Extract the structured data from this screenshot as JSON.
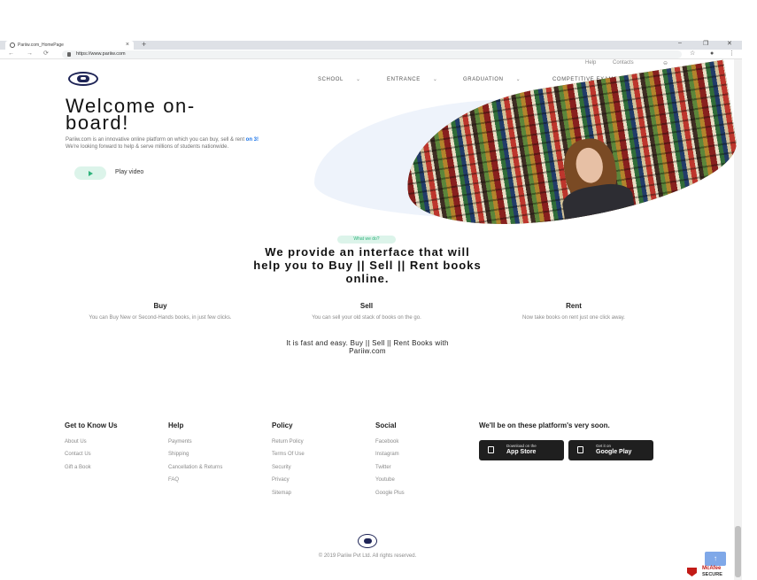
{
  "browser": {
    "tab_title": "Pariiw.com_HomePage",
    "tab_close": "×",
    "new_tab": "+",
    "url": "https://www.pariiw.com",
    "win_min": "–",
    "win_max": "❐",
    "win_close": "✕",
    "back": "←",
    "forward": "→",
    "reload": "⟳",
    "star": "☆",
    "menu": "⋮"
  },
  "header": {
    "utility_links": [
      "Help",
      "Contacts"
    ],
    "cart_icon": "⊖",
    "nav": [
      {
        "label": "SCHOOL",
        "chevron": "⌄"
      },
      {
        "label": "ENTRANCE",
        "chevron": "⌄"
      },
      {
        "label": "GRADUATION",
        "chevron": "⌄"
      },
      {
        "label": "COMPETITIVE EXAMS",
        "chevron": "⌄"
      }
    ]
  },
  "hero": {
    "title_line1": "Welcome on-",
    "title_line2": "board!",
    "desc_part1": "Pariiw.com is an innovative online platform on which you can buy, sell & rent ",
    "desc_accent": "on 3!",
    "desc_part2": "We're looking forward to help & serve millions of students nationwide.",
    "play_label": "Play video"
  },
  "about": {
    "pill": "What we do?",
    "title_line1": "We provide an interface that will",
    "title_line2": "help you to Buy || Sell || Rent books",
    "title_line3": "online.",
    "features": [
      {
        "title": "Buy",
        "desc": "You can Buy New or Second-Hands books, in just few clicks."
      },
      {
        "title": "Sell",
        "desc": "You can sell your old stack of books on the go."
      },
      {
        "title": "Rent",
        "desc": "Now take books on rent just one click away."
      }
    ],
    "fast_line1": "It is fast and easy. Buy || Sell || Rent Books with",
    "fast_line2": "Pariiw.com"
  },
  "footer": {
    "columns": [
      {
        "title": "Get to Know Us",
        "links": [
          "About Us",
          "Contact Us",
          "Gift a Book"
        ]
      },
      {
        "title": "Help",
        "links": [
          "Payments",
          "Shipping",
          "Cancellation & Returns",
          "FAQ"
        ]
      },
      {
        "title": "Policy",
        "links": [
          "Return Policy",
          "Terms Of Use",
          "Security",
          "Privacy",
          "Sitemap"
        ]
      },
      {
        "title": "Social",
        "links": [
          "Facebook",
          "Instagram",
          "Twitter",
          "Youtube",
          "Google Plus"
        ]
      }
    ],
    "platform_title": "We'll be on these platform's very soon.",
    "stores": [
      {
        "small": "Download on the",
        "big": "App Store"
      },
      {
        "small": "Get it on",
        "big": "Google Play"
      }
    ],
    "copyright": "© 2019 Pariiw Pvt Ltd. All rights reserved.",
    "to_top": "↑",
    "badge_line1": "McAfee",
    "badge_line2": "SECURE"
  }
}
